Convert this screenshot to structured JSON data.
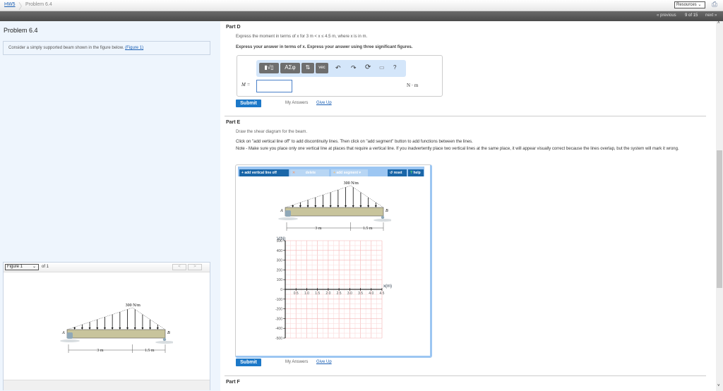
{
  "breadcrumb": {
    "root": "HW5",
    "current": "Problem 6.4"
  },
  "header": {
    "resources_label": "Resources",
    "previous": "« previous",
    "position": "9 of 15",
    "next": "next »"
  },
  "left": {
    "title": "Problem 6.4",
    "intro": "Consider a simply supported beam shown in the figure below.",
    "figure_link": "(Figure 1)",
    "figure_panel": {
      "select": "Figure 1",
      "of": "of 1",
      "prev": "<",
      "next": ">"
    }
  },
  "figure": {
    "load": "300 N/m",
    "label_a": "A",
    "label_b": "B",
    "dim1": "3 m",
    "dim2": "1.5 m"
  },
  "partD": {
    "title": "Part D",
    "prompt": "Express the moment in terms of x for 3 m < x ≤ 4.5 m, where x is in m.",
    "instruction": "Express your answer in terms of x. Express your answer using three significant figures.",
    "toolbar": [
      "▮√▯",
      "ΑΣφ",
      "⇅",
      "vec",
      "↶",
      "↷",
      "⟳",
      "▭",
      "?"
    ],
    "var_label": "M =",
    "value": "",
    "unit": "N · m",
    "submit": "Submit",
    "my_answers": "My Answers",
    "give_up": "Give Up"
  },
  "partE": {
    "title": "Part E",
    "prompt": "Draw the shear diagram for the beam.",
    "instruction": "Click on \"add vertical line off\" to add discontinuity lines. Then click on \"add segment\" button to add functions between the lines.",
    "note": "Note - Make sure you place only one vertical line at places that require a vertical line. If you inadvertently place two vertical lines at the same place, it will appear visually correct because the lines overlap, but the system will mark it wrong.",
    "widget": {
      "add_vertical": "add vertical line off",
      "delete": "delete",
      "add_segment": "add segment",
      "reset": "reset",
      "help": "help"
    },
    "submit": "Submit",
    "my_answers": "My Answers",
    "give_up": "Give Up"
  },
  "chart_data": {
    "type": "line",
    "xlabel": "x(m)",
    "ylabel": "V(N)",
    "xlim": [
      0,
      4.5
    ],
    "ylim": [
      -500,
      500
    ],
    "grid": true,
    "xticks": [
      "0.5",
      "1.0",
      "1.5",
      "2.0",
      "2.5",
      "3.0",
      "3.5",
      "4.0",
      "4.5"
    ],
    "yticks": [
      "500",
      "400",
      "300",
      "200",
      "100",
      "0",
      "-100",
      "-200",
      "-300",
      "-400",
      "-500"
    ],
    "series": []
  },
  "partF": {
    "title": "Part F"
  }
}
